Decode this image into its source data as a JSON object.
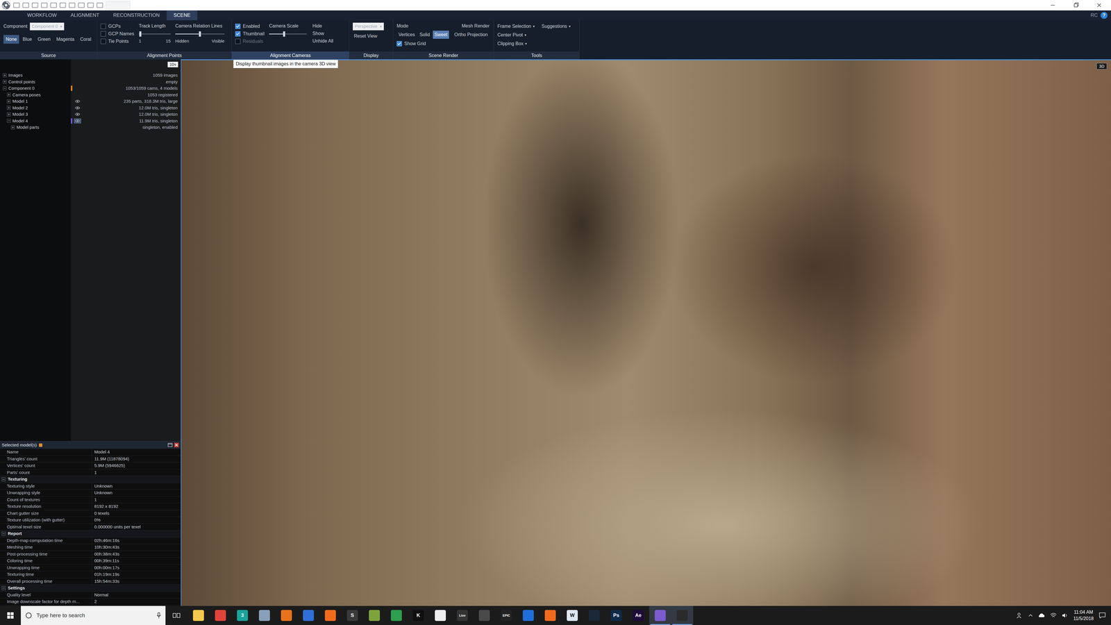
{
  "window": {
    "app_badge": "RC",
    "help": "?"
  },
  "menu_tabs": [
    {
      "label": "WORKFLOW",
      "selected": false
    },
    {
      "label": "ALIGNMENT",
      "selected": false
    },
    {
      "label": "RECONSTRUCTION",
      "selected": false
    },
    {
      "label": "SCENE",
      "selected": true
    }
  ],
  "ribbon": {
    "source": {
      "label": "Source",
      "component_label": "Component",
      "component_value": "Component 0",
      "component_disabled": true,
      "arrow": "▾",
      "colors": [
        {
          "label": "None",
          "selected": true
        },
        {
          "label": "Blue",
          "selected": false
        },
        {
          "label": "Green",
          "selected": false
        },
        {
          "label": "Magenta",
          "selected": false
        },
        {
          "label": "Coral",
          "selected": false
        }
      ]
    },
    "alignment_points": {
      "label": "Alignment Points",
      "checkboxes": [
        {
          "label": "GCPs",
          "checked": false,
          "disabled": false
        },
        {
          "label": "GCP Names",
          "checked": false,
          "disabled": false
        },
        {
          "label": "Tie Points",
          "checked": false,
          "disabled": false
        }
      ],
      "sliders": [
        {
          "label": "Track Length",
          "level": 0.05,
          "min": "1",
          "max": "15"
        },
        {
          "label": "Camera Relation Lines",
          "level": 0.5,
          "min": "Hidden",
          "max": "Visible"
        }
      ]
    },
    "alignment_cameras": {
      "label": "Alignment Cameras",
      "highlighted": true,
      "checkboxes": [
        {
          "label": "Enabled",
          "checked": true,
          "disabled": false
        },
        {
          "label": "Thumbnail",
          "checked": true,
          "disabled": false
        },
        {
          "label": "Residuals",
          "checked": false,
          "disabled": true
        }
      ],
      "camera_scale": {
        "label": "Camera Scale",
        "level": 0.4
      },
      "buttons": [
        "Hide",
        "Show",
        "Unhide All"
      ]
    },
    "display": {
      "label": "Display",
      "projection": "Perspective",
      "projection_disabled": true,
      "arrow": "▾",
      "reset": "Reset View"
    },
    "scene_render": {
      "label": "Scene Render",
      "mode_label": "Mode",
      "modes": [
        {
          "label": "Vertices",
          "selected": false
        },
        {
          "label": "Solid",
          "selected": false
        },
        {
          "label": "Sweet",
          "selected": true
        }
      ],
      "mesh_label": "Mesh Render",
      "ortho": "Ortho Projection",
      "show_grid": {
        "label": "Show Grid",
        "checked": true
      }
    },
    "tools": {
      "label": "Tools",
      "items": [
        {
          "label": "Frame Selection",
          "arrow": "▾"
        },
        {
          "label": "Suggestions",
          "arrow": "▾"
        },
        {
          "label": "Center Pivot",
          "arrow": "▾"
        },
        {
          "label": "Clipping Box",
          "arrow": "▾"
        }
      ]
    }
  },
  "tooltip": {
    "text": "Display thumbnail images in the camera 3D view"
  },
  "tree": {
    "badge": "1Ds",
    "rows": [
      {
        "label": "Images",
        "value": "1059 images",
        "depth": 0,
        "expandable": true,
        "expanded": false,
        "eye": false,
        "selected": false,
        "mark_color": null
      },
      {
        "label": "Control points",
        "value": "empty",
        "depth": 0,
        "expandable": true,
        "expanded": false,
        "eye": false,
        "selected": false,
        "mark_color": null
      },
      {
        "label": "Component 0",
        "value": "1053/1059 cams, 4 models",
        "depth": 0,
        "expandable": true,
        "expanded": true,
        "eye": false,
        "selected": false,
        "mark_color": "#e8891a"
      },
      {
        "label": "Camera poses",
        "value": "1053 registered",
        "depth": 1,
        "expandable": true,
        "expanded": false,
        "eye": false,
        "selected": false,
        "mark_color": null
      },
      {
        "label": "Model 1",
        "value": "235 parts, 318.3M tris, large",
        "depth": 1,
        "expandable": true,
        "expanded": false,
        "eye": true,
        "selected": false,
        "mark_color": null
      },
      {
        "label": "Model 2",
        "value": "12.0M tris, singleton",
        "depth": 1,
        "expandable": true,
        "expanded": false,
        "eye": true,
        "selected": false,
        "mark_color": null
      },
      {
        "label": "Model 3",
        "value": "12.0M tris, singleton",
        "depth": 1,
        "expandable": true,
        "expanded": false,
        "eye": true,
        "selected": false,
        "mark_color": null
      },
      {
        "label": "Model 4",
        "value": "11.9M tris, singleton",
        "depth": 1,
        "expandable": true,
        "expanded": true,
        "eye": true,
        "selected": true,
        "mark_color": "#7a5ce0"
      },
      {
        "label": "Model parts",
        "value": "singleton, enabled",
        "depth": 2,
        "expandable": true,
        "expanded": false,
        "eye": false,
        "selected": false,
        "mark_color": null
      }
    ]
  },
  "view": {
    "badge": "3D"
  },
  "properties": {
    "title": "Selected model(s)",
    "rows": [
      {
        "kind": "row",
        "name": "Name",
        "value": "Model 4"
      },
      {
        "kind": "row",
        "name": "Triangles' count",
        "value": "11.9M (11878094)"
      },
      {
        "kind": "row",
        "name": "Vertices' count",
        "value": "5.9M (5946625)"
      },
      {
        "kind": "row",
        "name": "Parts' count",
        "value": "1"
      },
      {
        "kind": "section",
        "name": "Texturing",
        "expanded": true
      },
      {
        "kind": "row",
        "name": "Texturing style",
        "value": "Unknown"
      },
      {
        "kind": "row",
        "name": "Unwrapping style",
        "value": "Unknown"
      },
      {
        "kind": "row",
        "name": "Count of textures",
        "value": "1"
      },
      {
        "kind": "row",
        "name": "Texture resolution",
        "value": "8192 x 8192"
      },
      {
        "kind": "row",
        "name": "Chart gutter size",
        "value": "0 texels"
      },
      {
        "kind": "row",
        "name": "Texture utilization (with gutter)",
        "value": "0%"
      },
      {
        "kind": "row",
        "name": "Optimal texel size",
        "value": "0.000000 units per texel"
      },
      {
        "kind": "section",
        "name": "Report",
        "expanded": true
      },
      {
        "kind": "row",
        "name": "Depth-map computation time",
        "value": "02h:46m:16s"
      },
      {
        "kind": "row",
        "name": "Meshing time",
        "value": "10h:30m:43s"
      },
      {
        "kind": "row",
        "name": "Post-processing time",
        "value": "00h:38m:43s"
      },
      {
        "kind": "row",
        "name": "Coloring time",
        "value": "00h:39m:11s"
      },
      {
        "kind": "row",
        "name": "Unwrapping time",
        "value": "00h:00m:17s"
      },
      {
        "kind": "row",
        "name": "Texturing time",
        "value": "01h:19m:19s"
      },
      {
        "kind": "row",
        "name": "Overall processing time",
        "value": "15h:54m:33s"
      },
      {
        "kind": "section",
        "name": "Settings",
        "expanded": true
      },
      {
        "kind": "row",
        "name": "Quality level",
        "value": "Normal"
      },
      {
        "kind": "row",
        "name": "Image downscale factor for depth m...",
        "value": "2"
      }
    ]
  },
  "taskbar": {
    "search_placeholder": "Type here to search",
    "apps": [
      {
        "label": "",
        "color": "#f2c94c",
        "active": false
      },
      {
        "label": "",
        "color": "#e0443a",
        "active": false
      },
      {
        "label": "3",
        "color": "#1aa39a",
        "active": false
      },
      {
        "label": "",
        "color": "#8aa0b8",
        "active": false
      },
      {
        "label": "",
        "color": "#e8731c",
        "active": false
      },
      {
        "label": "",
        "color": "#2f6fd6",
        "active": false
      },
      {
        "label": "",
        "color": "#f26b1d",
        "active": false
      },
      {
        "label": "S",
        "color": "#3a3a3a",
        "active": false
      },
      {
        "label": "",
        "color": "#7fa33c",
        "active": false
      },
      {
        "label": "",
        "color": "#2e9e4f",
        "active": false
      },
      {
        "label": "K",
        "color": "#0f0f0f",
        "active": false
      },
      {
        "label": "",
        "color": "#eeeeee",
        "active": false
      },
      {
        "label": "Live",
        "color": "#333333",
        "active": false
      },
      {
        "label": "",
        "color": "#4a4a4a",
        "active": false
      },
      {
        "label": "EPIC",
        "color": "#222222",
        "active": false
      },
      {
        "label": "",
        "color": "#1e6fd9",
        "active": false
      },
      {
        "label": "",
        "color": "#f26b1d",
        "active": false
      },
      {
        "label": "W",
        "color": "#dfe7f2",
        "active": false
      },
      {
        "label": "",
        "color": "#1b2838",
        "active": false
      },
      {
        "label": "Ps",
        "color": "#0d2a4a",
        "active": false
      },
      {
        "label": "Ae",
        "color": "#1f0a3a",
        "active": false
      },
      {
        "label": "",
        "color": "#7b5ccf",
        "active": true
      },
      {
        "label": "",
        "color": "#2b2b2b",
        "active": true
      }
    ],
    "time": "11:04 AM",
    "date": "11/5/2018"
  }
}
